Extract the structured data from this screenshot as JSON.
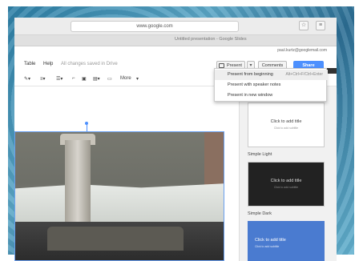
{
  "browser": {
    "url": "www.google.com",
    "tab_title": "Untitled presentation - Google Slides"
  },
  "account": {
    "email": "paul.kurtz@googlemail.com"
  },
  "menu": {
    "items": [
      "Table",
      "Help"
    ],
    "saved_status": "All changes saved in Drive"
  },
  "actions": {
    "present": "Present",
    "comments": "Comments",
    "share": "Share"
  },
  "toolbar": {
    "more_label": "More"
  },
  "present_menu": {
    "items": [
      {
        "label": "Present from beginning",
        "shortcut": "Alt+Ctrl+F/Ctrl+Enter"
      },
      {
        "label": "Present with speaker notes",
        "shortcut": ""
      },
      {
        "label": "Present in new window",
        "shortcut": ""
      }
    ]
  },
  "themes": {
    "thumb_title": "Click to add title",
    "thumb_subtitle": "Click to add subtitle",
    "names": [
      "Simple Light",
      "Simple Dark"
    ]
  },
  "colors": {
    "accent": "#4d90fe",
    "dark_theme": "#222222",
    "blue_theme": "#4a7bd0"
  }
}
